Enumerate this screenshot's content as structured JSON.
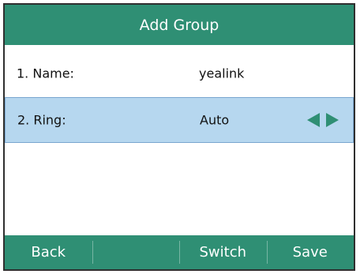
{
  "title": "Add Group",
  "rows": [
    {
      "label": "1. Name:",
      "value": "yealink"
    },
    {
      "label": "2. Ring:",
      "value": "Auto",
      "selected": true
    }
  ],
  "icons": {
    "left": "triangle-left-icon",
    "right": "triangle-right-icon"
  },
  "softkeys": [
    "Back",
    "",
    "Switch",
    "Save"
  ],
  "colors": {
    "accent": "#2f8f74",
    "selected_row": "#b6d7ef"
  }
}
